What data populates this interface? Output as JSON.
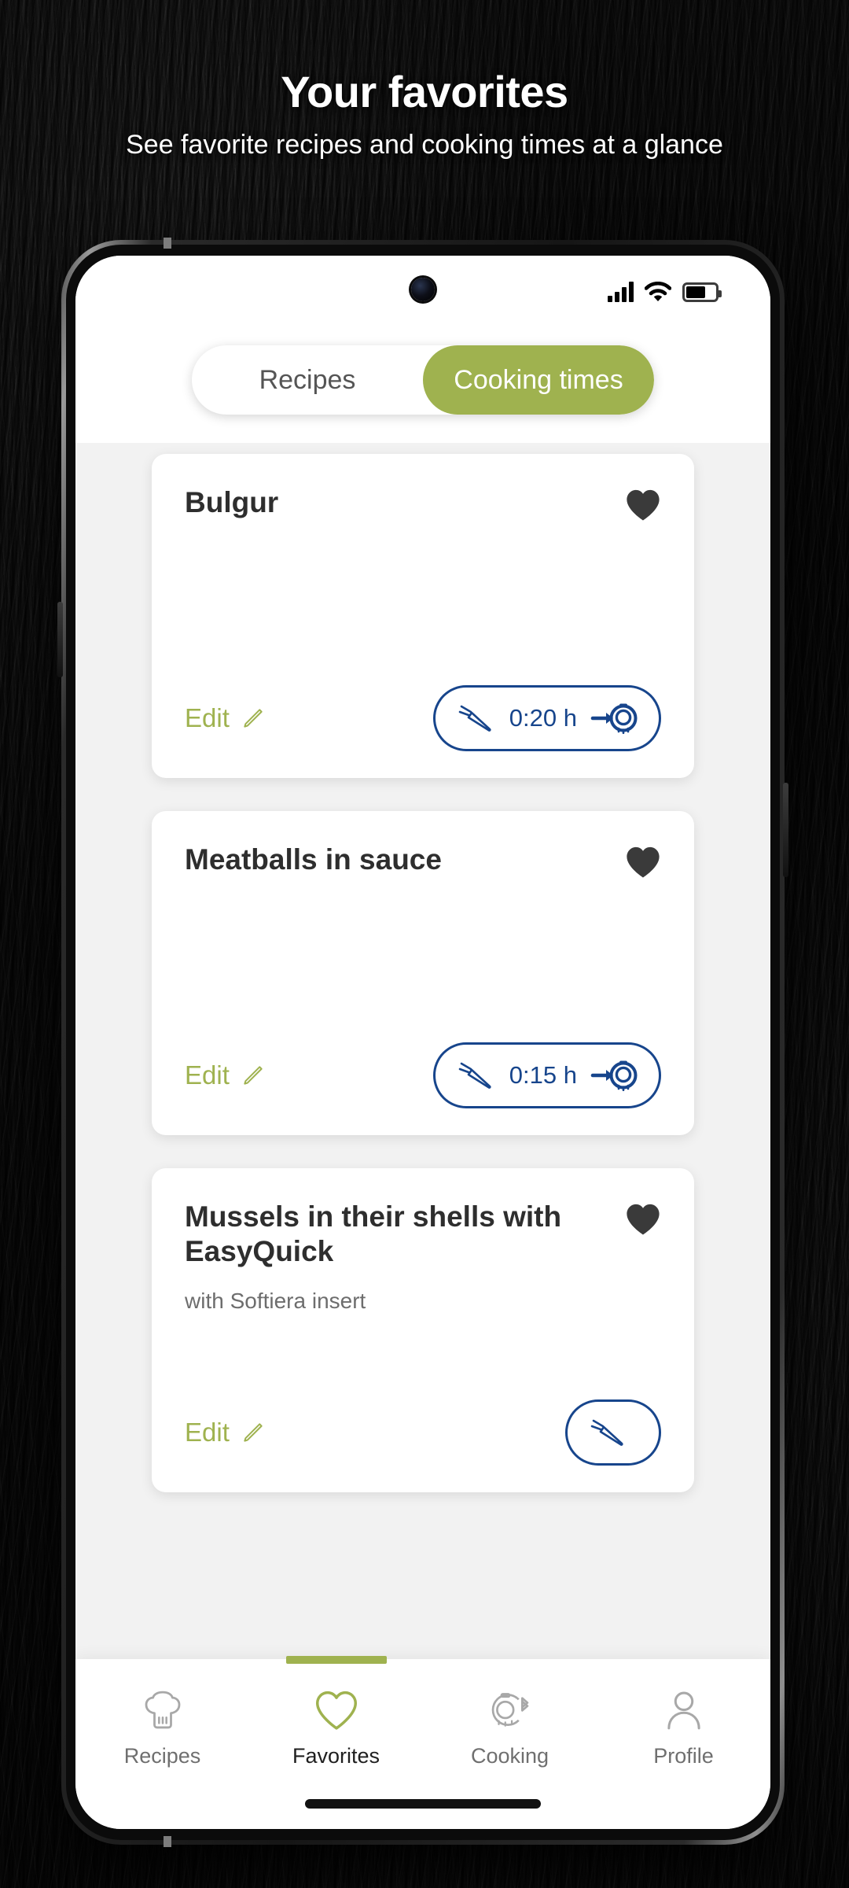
{
  "promo": {
    "title": "Your favorites",
    "subtitle": "See favorite recipes and cooking times at a glance"
  },
  "colors": {
    "accent_green": "#9fb24f",
    "accent_blue": "#17458c",
    "page_bg": "#f2f2f2",
    "card_bg": "#ffffff",
    "title_text": "#2e2e2e",
    "muted_text": "#6d6d6d"
  },
  "statusbar": {
    "signal_icon": "signal-bars-icon",
    "wifi_icon": "wifi-icon",
    "battery_icon": "battery-icon"
  },
  "tabs": {
    "items": [
      {
        "label": "Recipes",
        "active": false
      },
      {
        "label": "Cooking times",
        "active": true
      }
    ]
  },
  "cards": [
    {
      "title": "Bulgur",
      "subtitle": "",
      "favorite_icon": "heart-filled-icon",
      "edit_label": "Edit",
      "edit_icon": "pencil-icon",
      "time_value": "0:20 h",
      "food_icon": "carrot-icon",
      "appliance_icon": "pressure-cooker-icon"
    },
    {
      "title": "Meatballs in sauce",
      "subtitle": "",
      "favorite_icon": "heart-filled-icon",
      "edit_label": "Edit",
      "edit_icon": "pencil-icon",
      "time_value": "0:15 h",
      "food_icon": "carrot-icon",
      "appliance_icon": "pressure-cooker-icon"
    },
    {
      "title": "Mussels in their shells with EasyQuick",
      "subtitle": "with Softiera insert",
      "favorite_icon": "heart-filled-icon",
      "edit_label": "Edit",
      "edit_icon": "pencil-icon",
      "time_value": "",
      "food_icon": "carrot-icon",
      "appliance_icon": "pressure-cooker-icon"
    }
  ],
  "bottomnav": {
    "items": [
      {
        "label": "Recipes",
        "icon": "chef-hat-icon",
        "active": false
      },
      {
        "label": "Favorites",
        "icon": "heart-outline-icon",
        "active": true
      },
      {
        "label": "Cooking",
        "icon": "pot-bluetooth-icon",
        "active": false
      },
      {
        "label": "Profile",
        "icon": "person-icon",
        "active": false
      }
    ]
  }
}
